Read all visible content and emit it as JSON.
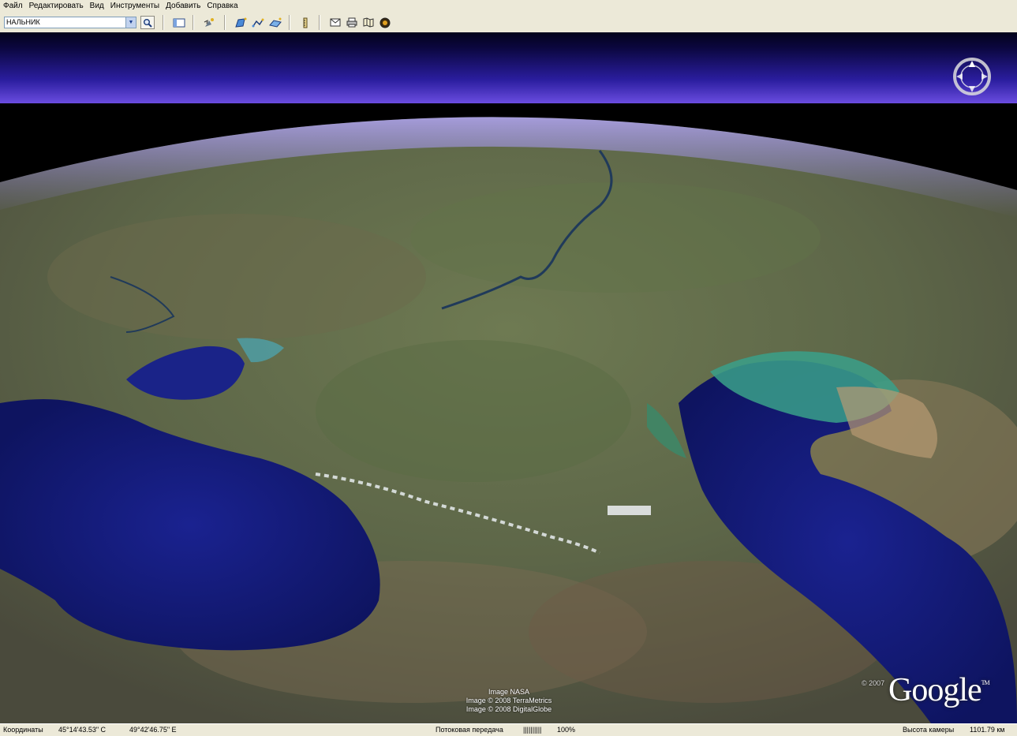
{
  "menu": [
    "Файл",
    "Редактировать",
    "Вид",
    "Инструменты",
    "Добавить",
    "Справка"
  ],
  "search": {
    "value": "НАЛЬНИК"
  },
  "toolbar_icons": [
    "search-icon",
    "sidebar-toggle-icon",
    "placemark-icon",
    "polygon-icon",
    "path-icon",
    "image-overlay-icon",
    "ruler-icon",
    "email-icon",
    "print-icon",
    "map-icon",
    "sky-icon"
  ],
  "map": {
    "credits": [
      "Image NASA",
      "Image © 2008 TerraMetrics",
      "Image © 2008 DigitalGlobe"
    ],
    "copyright": "© 2007",
    "logo_text": "Google",
    "logo_tm": "TM",
    "compass_label": "N"
  },
  "status": {
    "coords_label": "Координаты",
    "lat": "45°14'43.53\" С",
    "lon": "49°42'46.75\" Е",
    "streaming_label": "Потоковая передача",
    "streaming_bar": "||||||||||",
    "streaming_percent": "100%",
    "altitude_label": "Высота камеры",
    "altitude_value": "1101.79 км"
  },
  "colors": {
    "chrome": "#ece9d8",
    "atmosphere": "#6a4ce0",
    "sea": "#141a78"
  }
}
